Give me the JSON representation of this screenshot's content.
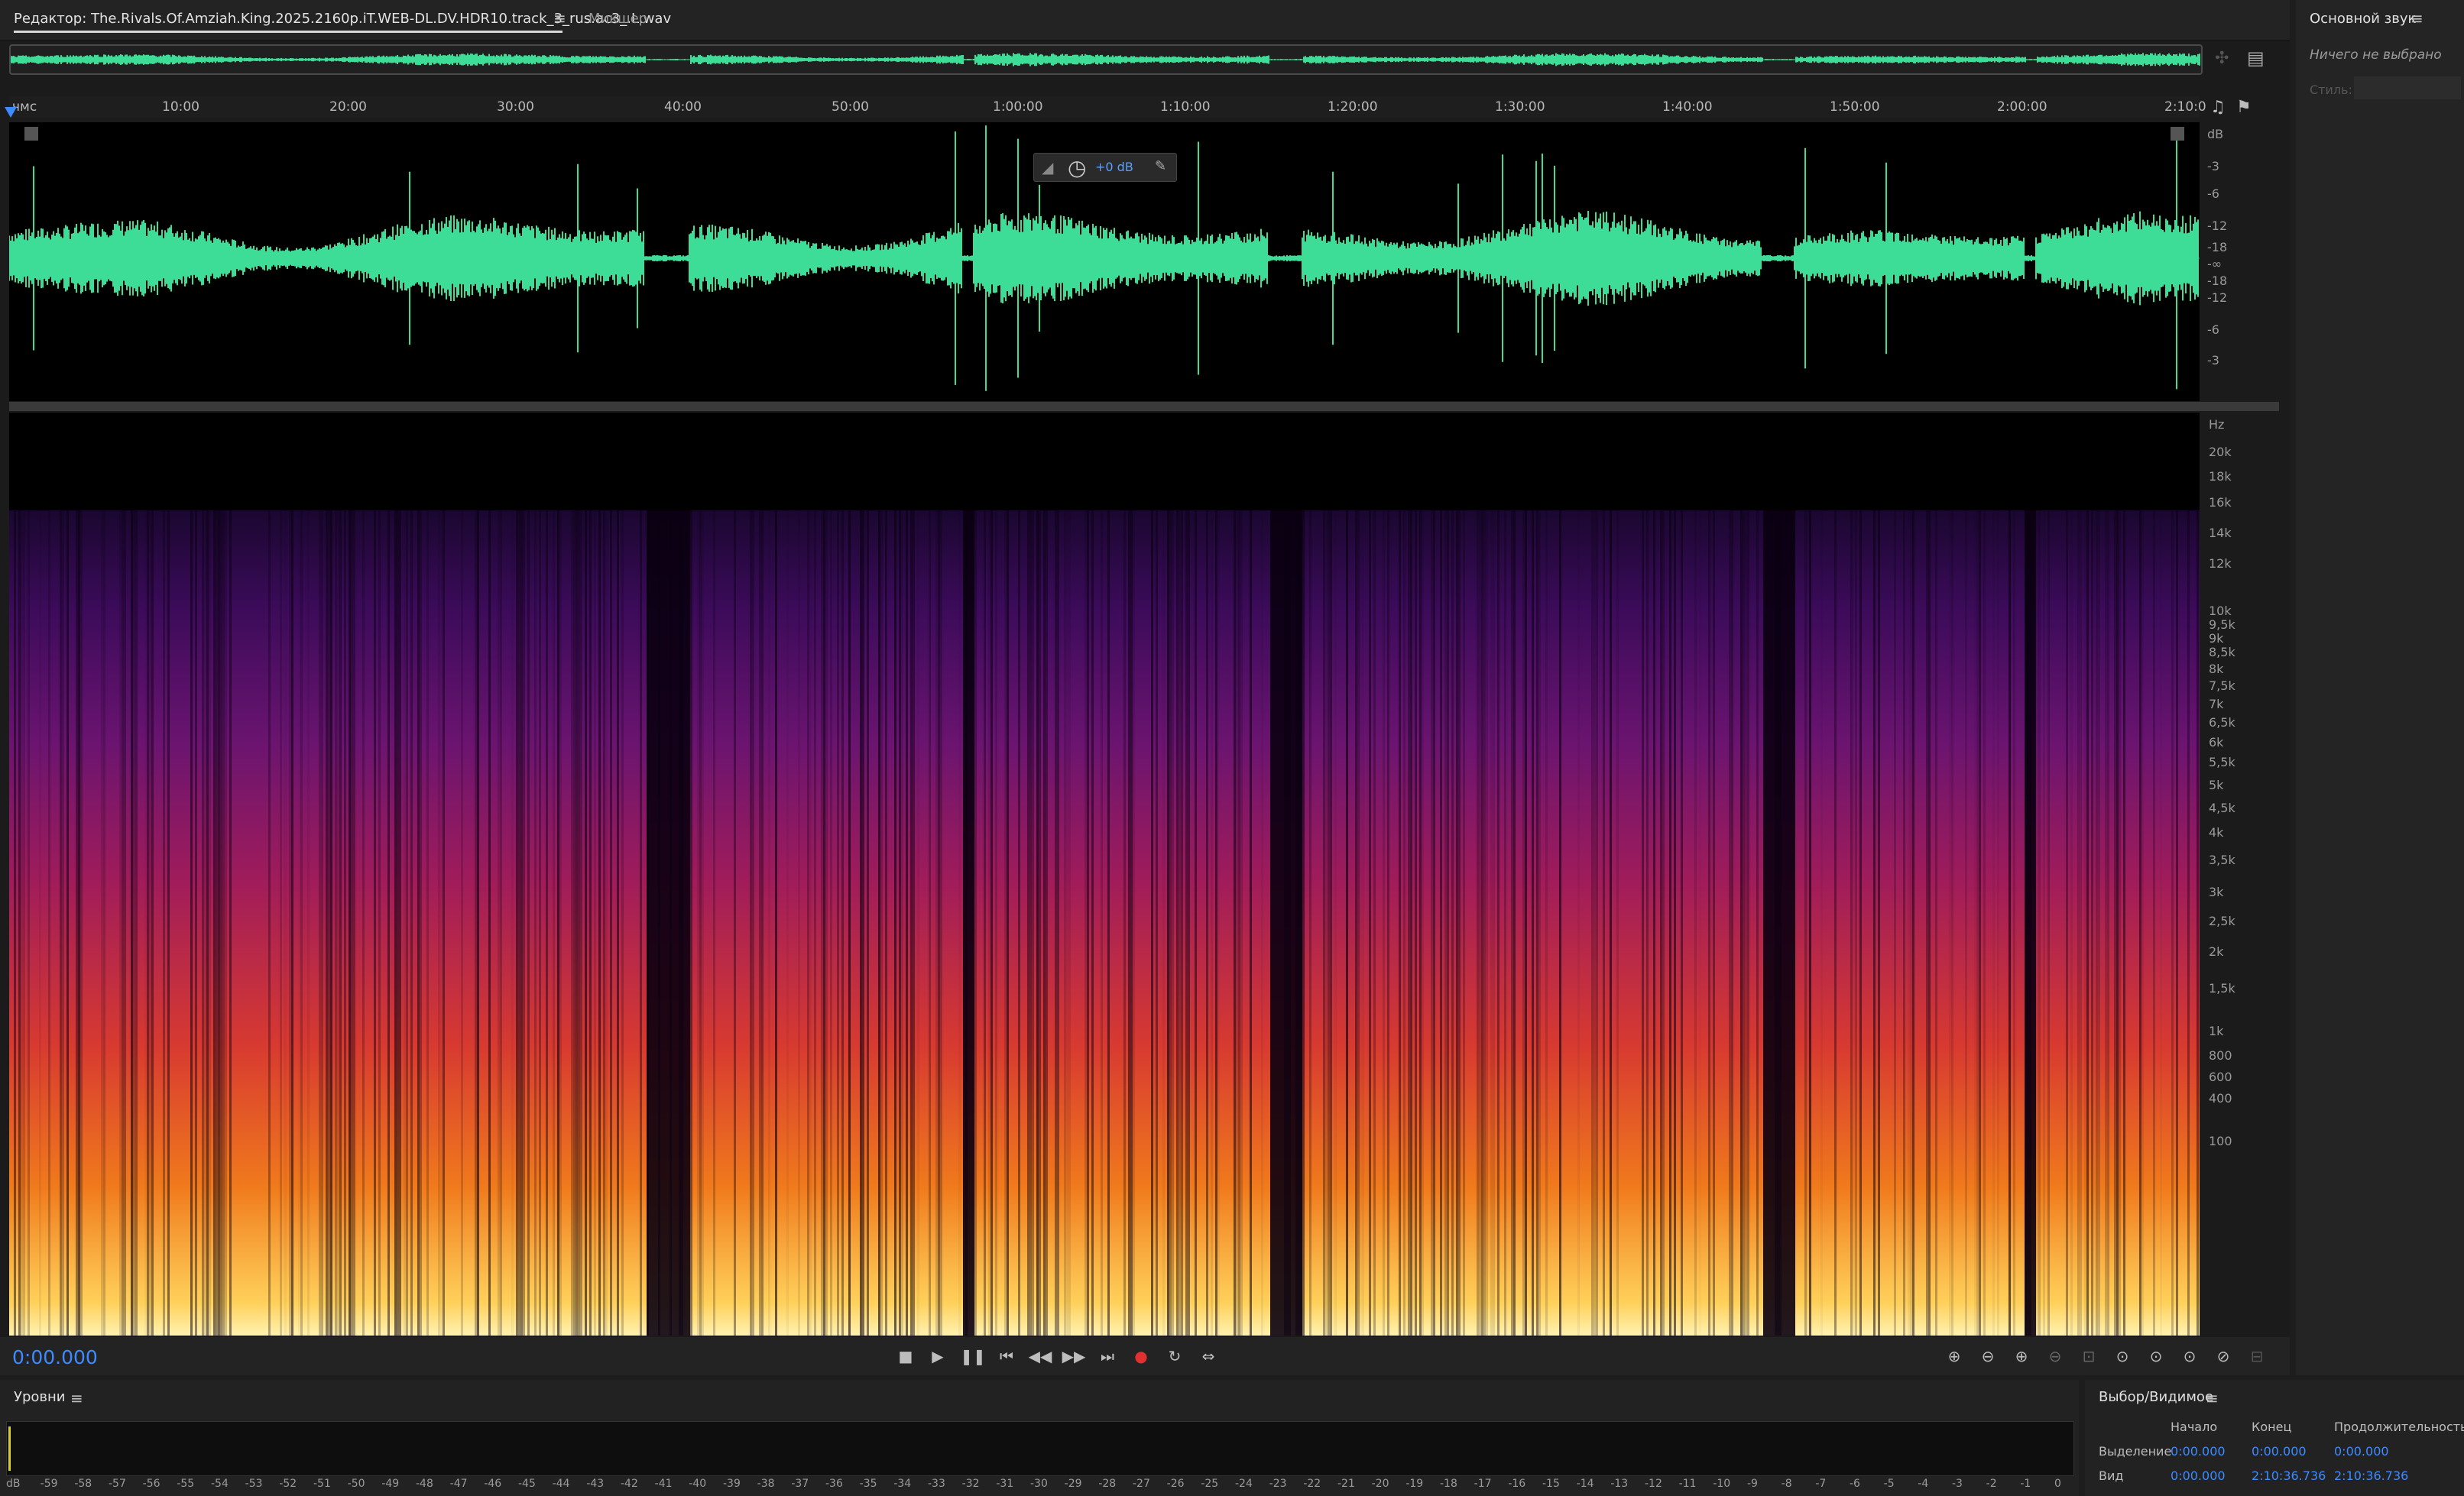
{
  "tabs": {
    "editor_label": "Редактор: The.Rivals.Of.Amziah.King.2025.2160p.iT.WEB-DL.DV.HDR10.track_3_rus.ac3_.L.wav",
    "menu_glyph": "≡",
    "mixer_label": "Микшер"
  },
  "ruler": {
    "unit": "чмс",
    "labels": [
      "10:00",
      "20:00",
      "30:00",
      "40:00",
      "50:00",
      "1:00:00",
      "1:10:00",
      "1:20:00",
      "1:30:00",
      "1:40:00",
      "1:50:00",
      "2:00:00",
      "2:10:0"
    ]
  },
  "waveform": {
    "scale_unit": "dB",
    "scale_labels": [
      "-3",
      "-6",
      "-12",
      "-18",
      "-∞",
      "-18",
      "-12",
      "-6",
      "-3"
    ],
    "hud_value": "+0 dB"
  },
  "spectrogram": {
    "scale_unit": "Hz",
    "scale_labels": [
      "20k",
      "18k",
      "16k",
      "14k",
      "12k",
      "10k",
      "9,5k",
      "9k",
      "8,5k",
      "8k",
      "7,5k",
      "7k",
      "6,5k",
      "6k",
      "5,5k",
      "5k",
      "4,5k",
      "4k",
      "3,5k",
      "3k",
      "2,5k",
      "2k",
      "1,5k",
      "1k",
      "800",
      "600",
      "400",
      "100"
    ]
  },
  "transport": {
    "current_time": "0:00.000",
    "buttons": [
      "stop-icon",
      "play-icon",
      "pause-icon",
      "skip-start-icon",
      "rewind-icon",
      "fast-forward-icon",
      "skip-end-icon",
      "record-icon",
      "loop-icon",
      "skip-selection-icon"
    ]
  },
  "essential_sound": {
    "title": "Основной звук",
    "empty_text": "Ничего не выбрано",
    "style_label": "Стиль:"
  },
  "levels": {
    "title": "Уровни",
    "scale": [
      "dB",
      "-59",
      "-58",
      "-57",
      "-56",
      "-55",
      "-54",
      "-53",
      "-52",
      "-51",
      "-50",
      "-49",
      "-48",
      "-47",
      "-46",
      "-45",
      "-44",
      "-43",
      "-42",
      "-41",
      "-40",
      "-39",
      "-38",
      "-37",
      "-36",
      "-35",
      "-34",
      "-33",
      "-32",
      "-31",
      "-30",
      "-29",
      "-28",
      "-27",
      "-26",
      "-25",
      "-24",
      "-23",
      "-22",
      "-21",
      "-20",
      "-19",
      "-18",
      "-17",
      "-16",
      "-15",
      "-14",
      "-13",
      "-12",
      "-11",
      "-10",
      "-9",
      "-8",
      "-7",
      "-6",
      "-5",
      "-4",
      "-3",
      "-2",
      "-1",
      "0"
    ]
  },
  "selection_view": {
    "title": "Выбор/Видимое",
    "headers": {
      "start": "Начало",
      "end": "Конец",
      "duration": "Продолжительность"
    },
    "rows": [
      {
        "label": "Выделение",
        "start": "0:00.000",
        "end": "0:00.000",
        "duration": "0:00.000"
      },
      {
        "label": "Вид",
        "start": "0:00.000",
        "end": "2:10:36.736",
        "duration": "2:10:36.736"
      }
    ]
  },
  "colors": {
    "waveform": "#3ddc97",
    "accent": "#3d8bff",
    "record": "#e03030"
  }
}
